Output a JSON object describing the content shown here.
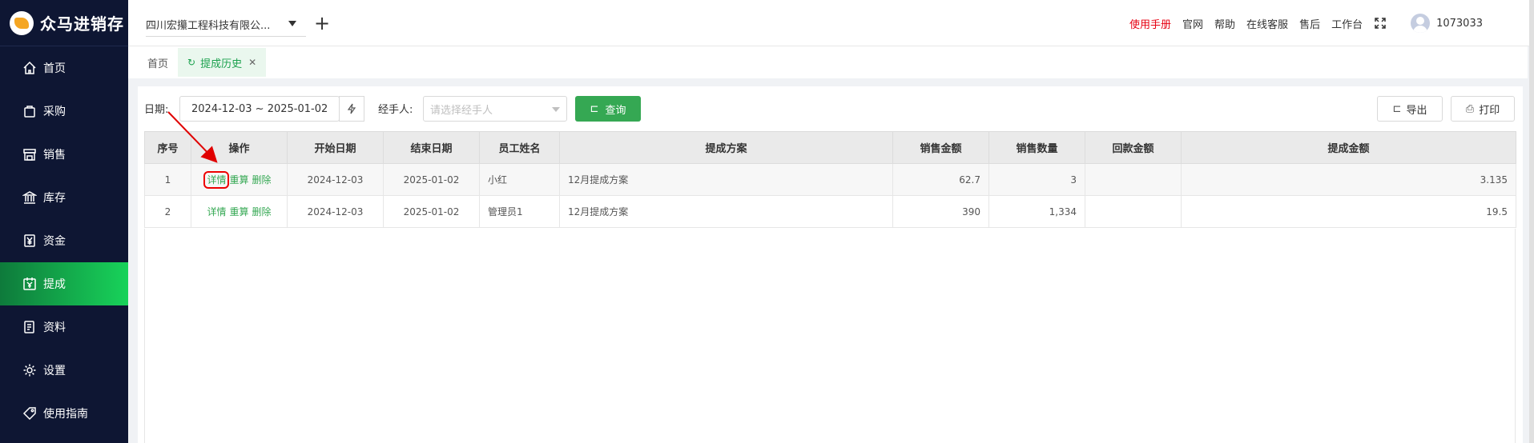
{
  "app": {
    "title": "众马进销存"
  },
  "sidebar": {
    "items": [
      {
        "label": "首页",
        "icon": "home-icon"
      },
      {
        "label": "采购",
        "icon": "bag-icon"
      },
      {
        "label": "销售",
        "icon": "shop-icon"
      },
      {
        "label": "库存",
        "icon": "bank-icon"
      },
      {
        "label": "资金",
        "icon": "yen-icon"
      },
      {
        "label": "提成",
        "icon": "calendar-yen-icon",
        "active": true
      },
      {
        "label": "资料",
        "icon": "document-icon"
      },
      {
        "label": "设置",
        "icon": "gear-icon"
      },
      {
        "label": "使用指南",
        "icon": "tag-icon"
      }
    ],
    "active_color": "#18d35a"
  },
  "header": {
    "company": "四川宏攥工程科技有限公...",
    "links": [
      "使用手册",
      "官网",
      "帮助",
      "在线客服",
      "售后",
      "工作台"
    ],
    "highlight_color": "#e60012",
    "user_id": "1073033"
  },
  "tabs": [
    {
      "label": "首页"
    },
    {
      "label": "提成历史",
      "active": true
    }
  ],
  "filters": {
    "date_label": "日期:",
    "date_value": "2024-12-03 ~ 2025-01-02",
    "handler_label": "经手人:",
    "handler_placeholder": "请选择经手人",
    "query_label": "查询",
    "export_label": "导出",
    "print_label": "打印"
  },
  "table": {
    "headers": [
      "序号",
      "操作",
      "开始日期",
      "结束日期",
      "员工姓名",
      "提成方案",
      "销售金额",
      "销售数量",
      "回款金额",
      "提成金额"
    ],
    "actions": [
      "详情",
      "重算",
      "删除"
    ],
    "rows": [
      {
        "no": "1",
        "start": "2024-12-03",
        "end": "2025-01-02",
        "name": "小红",
        "plan": "12月提成方案",
        "sales_amount": "62.7",
        "sales_qty": "3",
        "return_amount": "",
        "commission": "3.135"
      },
      {
        "no": "2",
        "start": "2024-12-03",
        "end": "2025-01-02",
        "name": "管理员1",
        "plan": "12月提成方案",
        "sales_amount": "390",
        "sales_qty": "1,334",
        "return_amount": "",
        "commission": "19.5"
      }
    ]
  },
  "theme": {
    "green": "#35a853",
    "annotation_red": "#e00000"
  }
}
